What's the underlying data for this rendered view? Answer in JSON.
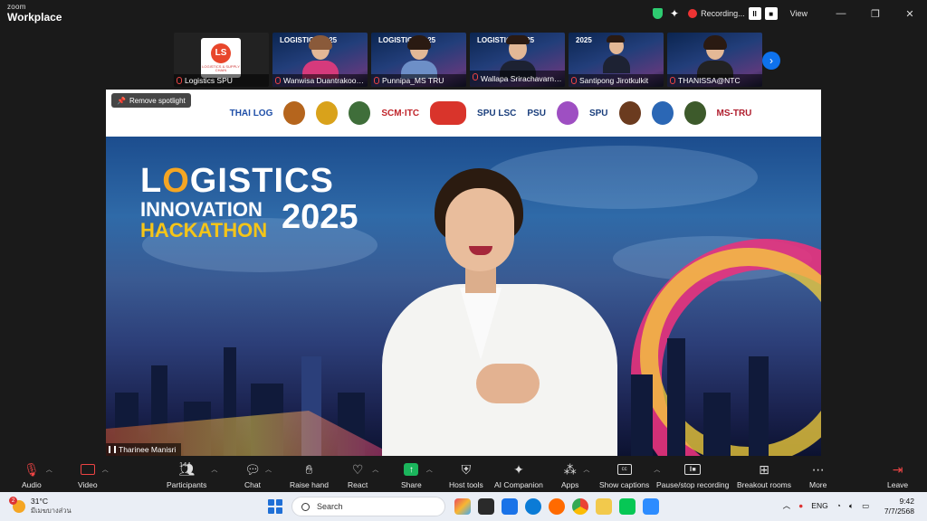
{
  "window": {
    "brand_top": "zoom",
    "brand_bottom": "Workplace",
    "recording_label": "Recording...",
    "view_label": "View",
    "pause_glyph": "II",
    "stop_glyph": "■"
  },
  "participants_strip": [
    {
      "name": "Logistics SPU"
    },
    {
      "name": "Wanwisa Duantrakoon..."
    },
    {
      "name": "Punnipa_MS TRU"
    },
    {
      "name": "Wallapa Srirachavarn วิลลา..."
    },
    {
      "name": "Santipong Jirotkulkit"
    },
    {
      "name": "THANISSA@NTC"
    }
  ],
  "thumb_logo": {
    "emblem": "LS",
    "caption": "LOGISTICS & SUPPLY CHAIN"
  },
  "thumb_titles": [
    "LOGISTICS 2025",
    "LOGISTICS 2025",
    "LOGISTICS 2025",
    "2025"
  ],
  "spotlight": {
    "remove_label": "Remove spotlight",
    "speaker_name": "Tharinee Manisri",
    "logos": [
      "THAI LOG",
      "SCM·ITC",
      "SPU LSC",
      "PSU",
      "SPU",
      "MS-TRU"
    ],
    "banner": {
      "line1_pre": "L",
      "line1_o": "O",
      "line1_post": "GISTICS",
      "line2": "INNOVATION",
      "line3": "HACKATHON",
      "year": "2025"
    }
  },
  "toolbar": {
    "audio": "Audio",
    "video": "Video",
    "participants": "Participants",
    "participant_count": "144",
    "chat": "Chat",
    "raise_hand": "Raise hand",
    "react": "React",
    "share": "Share",
    "host_tools": "Host tools",
    "ai_companion": "AI Companion",
    "apps": "Apps",
    "show_captions": "Show captions",
    "pause_recording": "Pause/stop recording",
    "breakout_rooms": "Breakout rooms",
    "more": "More",
    "leave": "Leave"
  },
  "taskbar": {
    "weather_temp": "31°C",
    "weather_desc": "มีเมฆบางส่วน",
    "weather_badge": "2",
    "search_placeholder": "Search",
    "lang": "ENG",
    "time": "9:42",
    "date": "7/7/2568"
  }
}
